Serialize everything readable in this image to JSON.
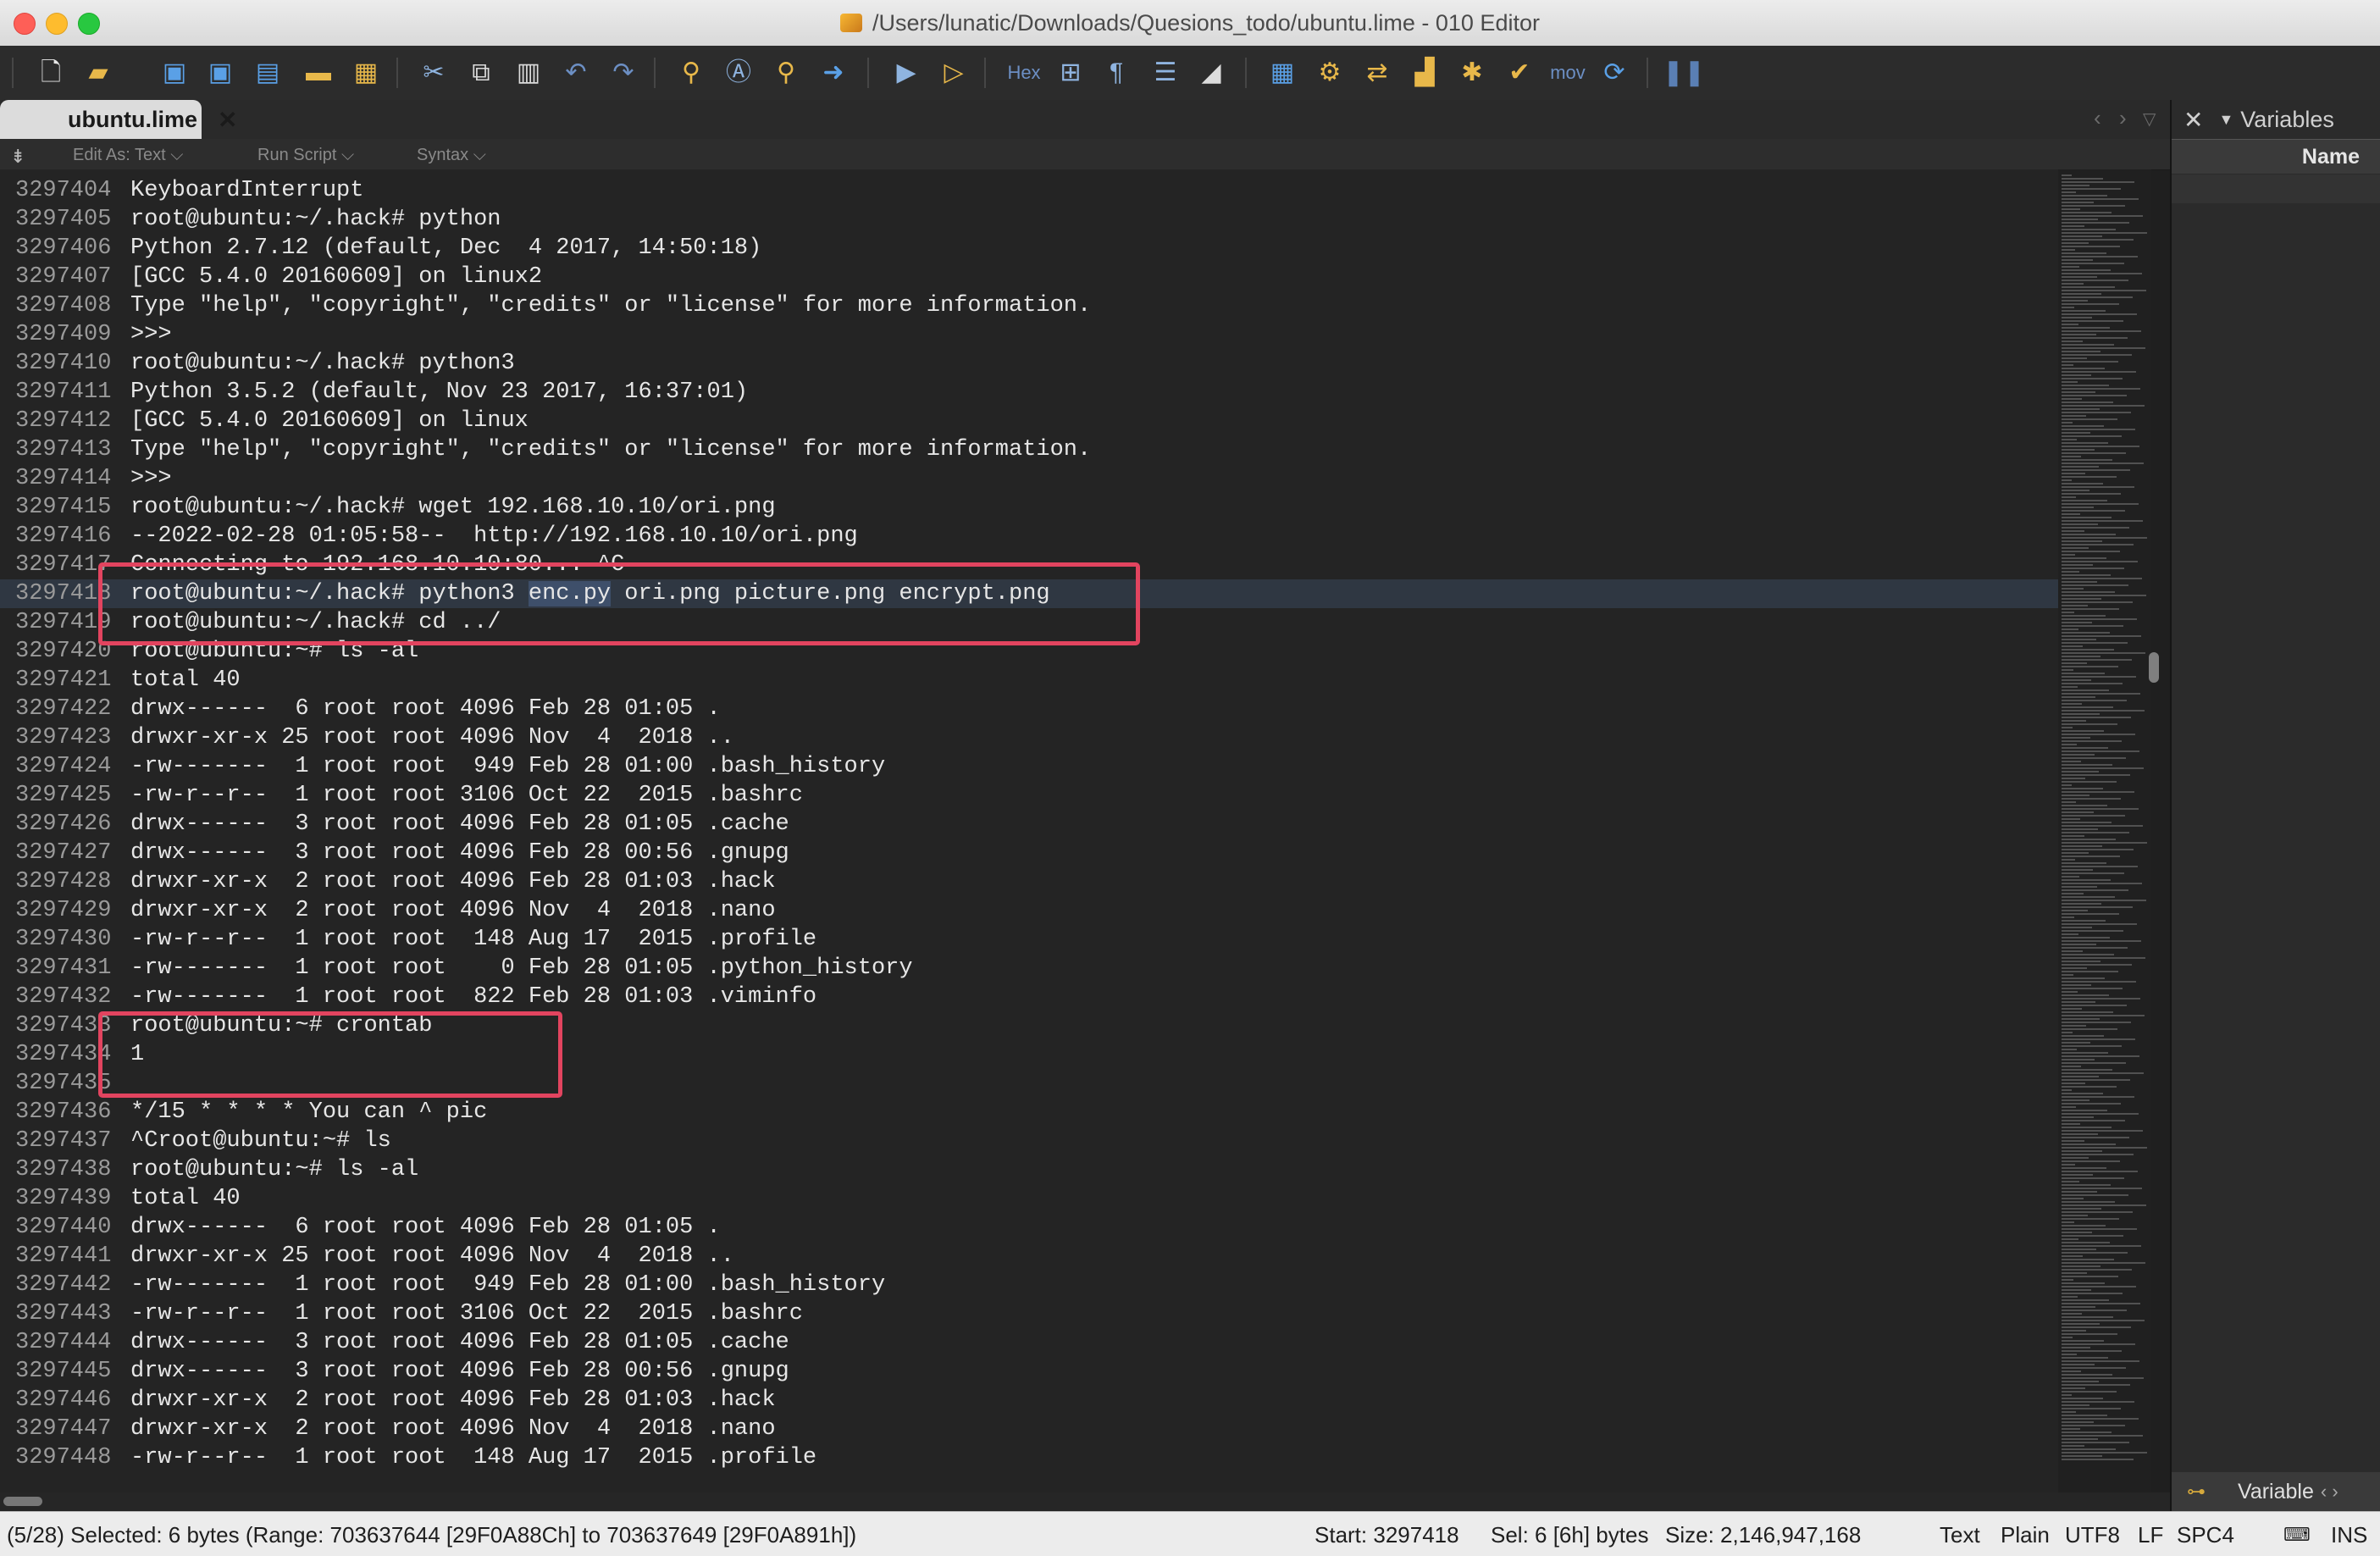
{
  "window": {
    "title": "/Users/lunatic/Downloads/Quesions_todo/ubuntu.lime - 010 Editor"
  },
  "toolbar": {
    "icons": [
      "new-file-icon",
      "open-file-icon",
      "save-icon",
      "save-as-icon",
      "save-all-icon",
      "open-folder-icon",
      "workspace-icon",
      "cut-icon",
      "copy-icon",
      "paste-icon",
      "undo-icon",
      "redo-icon",
      "find-icon",
      "replace-icon",
      "find-in-files-icon",
      "goto-icon",
      "run-template-icon",
      "run-script-icon",
      "hex-mode-icon",
      "byte-columns-icon",
      "pilcrow-icon",
      "columns-icon",
      "highlight-icon",
      "calculator-icon",
      "inspector-icon",
      "compare-icon",
      "histogram-icon",
      "checksum-icon",
      "verify-icon",
      "disassembler-icon",
      "base-convert-icon",
      "pause-icon"
    ],
    "hex_label": "Hex",
    "mov_label": "mov"
  },
  "tabs": {
    "active": "ubuntu.lime",
    "close_glyph": "✕"
  },
  "options_bar": {
    "edit_as": "Edit As: Text",
    "run_script": "Run Script",
    "syntax": "Syntax"
  },
  "editor": {
    "lines": [
      {
        "num": "3297404",
        "text": "KeyboardInterrupt"
      },
      {
        "num": "3297405",
        "text": "root@ubuntu:~/.hack# python"
      },
      {
        "num": "3297406",
        "text": "Python 2.7.12 (default, Dec  4 2017, 14:50:18)"
      },
      {
        "num": "3297407",
        "text": "[GCC 5.4.0 20160609] on linux2"
      },
      {
        "num": "3297408",
        "text": "Type \"help\", \"copyright\", \"credits\" or \"license\" for more information."
      },
      {
        "num": "3297409",
        "text": ">>>"
      },
      {
        "num": "3297410",
        "text": "root@ubuntu:~/.hack# python3"
      },
      {
        "num": "3297411",
        "text": "Python 3.5.2 (default, Nov 23 2017, 16:37:01)"
      },
      {
        "num": "3297412",
        "text": "[GCC 5.4.0 20160609] on linux"
      },
      {
        "num": "3297413",
        "text": "Type \"help\", \"copyright\", \"credits\" or \"license\" for more information."
      },
      {
        "num": "3297414",
        "text": ">>>"
      },
      {
        "num": "3297415",
        "text": "root@ubuntu:~/.hack# wget 192.168.10.10/ori.png"
      },
      {
        "num": "3297416",
        "text": "--2022-02-28 01:05:58--  http://192.168.10.10/ori.png"
      },
      {
        "num": "3297417",
        "text": "Connecting to 192.168.10.10:80... ^C"
      },
      {
        "num": "3297418",
        "text": "root@ubuntu:~/.hack# python3 ",
        "sel": "enc.py",
        "after": " ori.png picture.png encrypt.png",
        "current": true
      },
      {
        "num": "3297419",
        "text": "root@ubuntu:~/.hack# cd ../"
      },
      {
        "num": "3297420",
        "text": "root@ubuntu:~# ls -al"
      },
      {
        "num": "3297421",
        "text": "total 40"
      },
      {
        "num": "3297422",
        "text": "drwx------  6 root root 4096 Feb 28 01:05 ."
      },
      {
        "num": "3297423",
        "text": "drwxr-xr-x 25 root root 4096 Nov  4  2018 .."
      },
      {
        "num": "3297424",
        "text": "-rw-------  1 root root  949 Feb 28 01:00 .bash_history"
      },
      {
        "num": "3297425",
        "text": "-rw-r--r--  1 root root 3106 Oct 22  2015 .bashrc"
      },
      {
        "num": "3297426",
        "text": "drwx------  3 root root 4096 Feb 28 01:05 .cache"
      },
      {
        "num": "3297427",
        "text": "drwx------  3 root root 4096 Feb 28 00:56 .gnupg"
      },
      {
        "num": "3297428",
        "text": "drwxr-xr-x  2 root root 4096 Feb 28 01:03 .hack"
      },
      {
        "num": "3297429",
        "text": "drwxr-xr-x  2 root root 4096 Nov  4  2018 .nano"
      },
      {
        "num": "3297430",
        "text": "-rw-r--r--  1 root root  148 Aug 17  2015 .profile"
      },
      {
        "num": "3297431",
        "text": "-rw-------  1 root root    0 Feb 28 01:05 .python_history"
      },
      {
        "num": "3297432",
        "text": "-rw-------  1 root root  822 Feb 28 01:03 .viminfo"
      },
      {
        "num": "3297433",
        "text": "root@ubuntu:~# crontab"
      },
      {
        "num": "3297434",
        "text": "1"
      },
      {
        "num": "3297435",
        "text": ""
      },
      {
        "num": "3297436",
        "text": "*/15 * * * * You can ^ pic"
      },
      {
        "num": "3297437",
        "text": "^Croot@ubuntu:~# ls"
      },
      {
        "num": "3297438",
        "text": "root@ubuntu:~# ls -al"
      },
      {
        "num": "3297439",
        "text": "total 40"
      },
      {
        "num": "3297440",
        "text": "drwx------  6 root root 4096 Feb 28 01:05 ."
      },
      {
        "num": "3297441",
        "text": "drwxr-xr-x 25 root root 4096 Nov  4  2018 .."
      },
      {
        "num": "3297442",
        "text": "-rw-------  1 root root  949 Feb 28 01:00 .bash_history"
      },
      {
        "num": "3297443",
        "text": "-rw-r--r--  1 root root 3106 Oct 22  2015 .bashrc"
      },
      {
        "num": "3297444",
        "text": "drwx------  3 root root 4096 Feb 28 01:05 .cache"
      },
      {
        "num": "3297445",
        "text": "drwx------  3 root root 4096 Feb 28 00:56 .gnupg"
      },
      {
        "num": "3297446",
        "text": "drwxr-xr-x  2 root root 4096 Feb 28 01:03 .hack"
      },
      {
        "num": "3297447",
        "text": "drwxr-xr-x  2 root root 4096 Nov  4  2018 .nano"
      },
      {
        "num": "3297448",
        "text": "-rw-r--r--  1 root root  148 Aug 17  2015 .profile"
      }
    ]
  },
  "variables_panel": {
    "title": "Variables",
    "column_name": "Name",
    "footer_label": "Variable"
  },
  "status_bar": {
    "selection_info": "(5/28) Selected: 6 bytes (Range: 703637644 [29F0A88Ch] to 703637649 [29F0A891h])",
    "start": "Start: 3297418",
    "sel": "Sel: 6 [6h] bytes",
    "size": "Size: 2,146,947,168",
    "mode": "Text",
    "highlight": "Plain",
    "encoding": "UTF8",
    "line_ending": "LF",
    "indent": "SPC4",
    "insert_mode": "INS"
  },
  "colors": {
    "accent": "#3c6fb8",
    "annotation_box": "#e2445f",
    "editor_bg": "#242424"
  }
}
